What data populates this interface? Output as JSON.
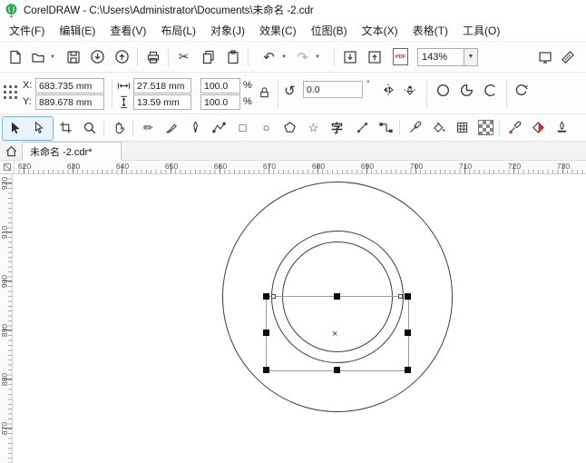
{
  "window": {
    "title": "CorelDRAW - C:\\Users\\Administrator\\Documents\\未命名 -2.cdr"
  },
  "menu": {
    "items": [
      "文件(F)",
      "编辑(E)",
      "查看(V)",
      "布局(L)",
      "对象(J)",
      "效果(C)",
      "位图(B)",
      "文本(X)",
      "表格(T)",
      "工具(O)"
    ]
  },
  "toolbar": {
    "zoom_level": "143%",
    "pdf_label": "PDF"
  },
  "property_bar": {
    "x_label": "X:",
    "y_label": "Y:",
    "x_value": "683.735 mm",
    "y_value": "889.678 mm",
    "width_value": "27.518 mm",
    "height_value": "13.59 mm",
    "scale_x_value": "100.0",
    "scale_y_value": "100.0",
    "scale_x_unit": "%",
    "scale_y_unit": "%",
    "rotation_value": "0.0",
    "rotation_unit": "°"
  },
  "toolbox": {
    "text_tool_label": "字"
  },
  "tabs": {
    "active_document": "未命名 -2.cdr*"
  },
  "rulers": {
    "horizontal": [
      "620",
      "630",
      "640",
      "650",
      "660",
      "670",
      "680",
      "690",
      "700",
      "710",
      "720",
      "730"
    ],
    "vertical": [
      "920",
      "910",
      "900",
      "890",
      "880",
      "870"
    ]
  },
  "colors": {
    "logo_green": "#2aa94f",
    "tool_highlight_bg": "#e9f3fb",
    "selection_handle": "#0d0d0d"
  }
}
